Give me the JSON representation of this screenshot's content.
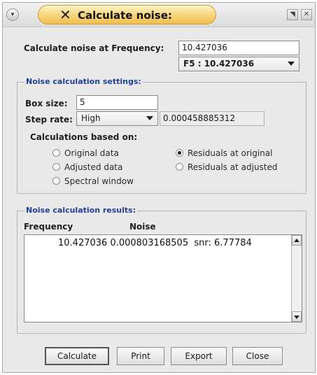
{
  "window": {
    "title": "Calculate noise:",
    "menu_icon": "chevron-down-icon",
    "minimize_icon": "minimize-icon",
    "close_icon": "close-icon",
    "menu_glyph": "▾",
    "minimize_glyph": "◥",
    "close_glyph": "✕",
    "x_glyph": "✕"
  },
  "top": {
    "frequency_label": "Calculate noise at Frequency:",
    "frequency_value": "10.427036",
    "frequency_select": "F5  :  10.427036"
  },
  "settings": {
    "group_title": "Noise calculation settings:",
    "box_size_label": "Box size:",
    "box_size_value": "5",
    "step_rate_label": "Step rate:",
    "step_rate_value": "High",
    "step_rate_number": "0.000458885312",
    "based_on_label": "Calculations based on:",
    "options": [
      {
        "label": "Original data",
        "selected": false
      },
      {
        "label": "Residuals at original",
        "selected": true
      },
      {
        "label": "Adjusted data",
        "selected": false
      },
      {
        "label": "Residuals at adjusted",
        "selected": false
      },
      {
        "label": "Spectral window",
        "selected": false
      }
    ]
  },
  "results": {
    "group_title": "Noise calculation results:",
    "col_frequency": "Frequency",
    "col_noise": "Noise",
    "line": "10.427036 0.000803168505  snr: 6.77784"
  },
  "buttons": {
    "calculate": "Calculate",
    "print": "Print",
    "export": "Export",
    "close": "Close"
  }
}
